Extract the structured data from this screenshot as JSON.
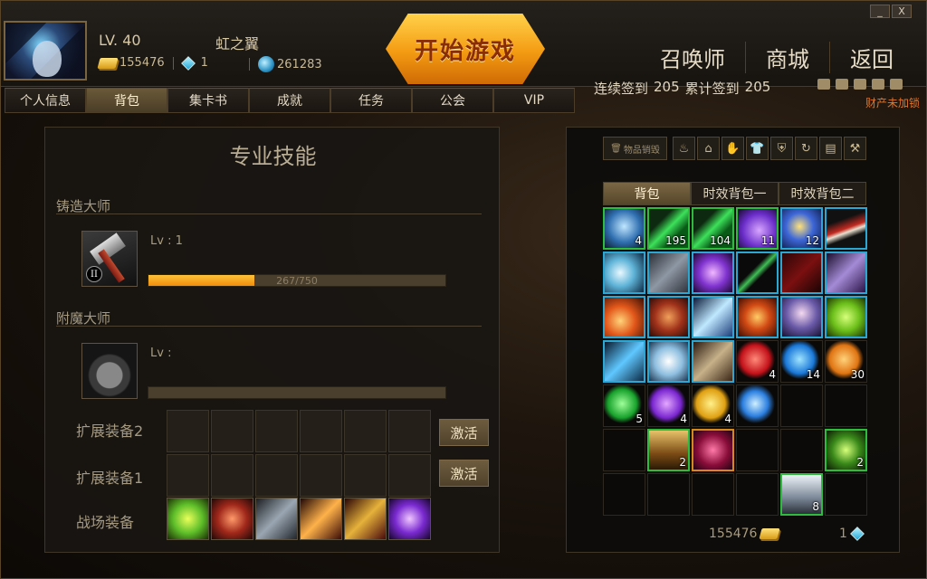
{
  "window": {
    "minimize": "_",
    "close": "X"
  },
  "player": {
    "level": "LV. 40",
    "name": "虹之翼",
    "gold": "155476",
    "gems": "1",
    "points": "261283"
  },
  "start_button": "开始游戏",
  "top_nav": [
    "召唤师",
    "商城",
    "返回"
  ],
  "tabs": [
    "个人信息",
    "背包",
    "集卡书",
    "成就",
    "任务",
    "公会",
    "VIP"
  ],
  "active_tab": "背包",
  "signin": {
    "consecutive_label": "连续签到",
    "consecutive_value": "205",
    "total_label": "累计签到",
    "total_value": "205"
  },
  "asset_lock": "财产未加锁",
  "skills_panel": {
    "title": "专业技能",
    "forge": {
      "name": "铸造大师",
      "lv": "Lv : 1",
      "progress_text": "267/750",
      "progress": 0.356,
      "roman": "II"
    },
    "enchant": {
      "name": "附魔大师",
      "lv": "Lv :",
      "progress": 0
    }
  },
  "equipment_rows": [
    {
      "label": "扩展装备2",
      "button": "激活"
    },
    {
      "label": "扩展装备1",
      "button": "激活"
    },
    {
      "label": "战场装备"
    }
  ],
  "bag_panel": {
    "sell_label": "物品销毁",
    "tabs": [
      "背包",
      "时效背包一",
      "时效背包二"
    ],
    "active_tab": "背包",
    "gold": "155476",
    "gems": "1"
  },
  "colors": {
    "accent": "#f39b12",
    "lock_warning": "#e2742a",
    "green_border": "#2fbb3e",
    "blue_border": "#2aa7d3"
  },
  "bag_items": [
    {
      "icon": "beast-icon",
      "count": "4",
      "rarity": "g"
    },
    {
      "icon": "green-potion-icon",
      "count": "195",
      "rarity": "g"
    },
    {
      "icon": "green-potion-icon",
      "count": "104",
      "rarity": "g"
    },
    {
      "icon": "purple-potion-icon",
      "count": "11",
      "rarity": "g"
    },
    {
      "icon": "blue-scroll-icon",
      "count": "12",
      "rarity": "b"
    },
    {
      "icon": "red-blade-icon",
      "count": "",
      "rarity": "b"
    },
    {
      "icon": "ice-wave-icon",
      "count": "",
      "rarity": "b"
    },
    {
      "icon": "grey-rune-icon",
      "count": "",
      "rarity": "b"
    },
    {
      "icon": "purple-wing-icon",
      "count": "",
      "rarity": "b"
    },
    {
      "icon": "green-sword-icon",
      "count": "",
      "rarity": "b"
    },
    {
      "icon": "red-card-icon",
      "count": "",
      "rarity": "b"
    },
    {
      "icon": "purple-blades-icon",
      "count": "",
      "rarity": "b"
    },
    {
      "icon": "fire-slash-icon",
      "count": "",
      "rarity": "b"
    },
    {
      "icon": "red-spiral-icon",
      "count": "",
      "rarity": "b"
    },
    {
      "icon": "blue-swords-icon",
      "count": "",
      "rarity": "b"
    },
    {
      "icon": "red-wheel-icon",
      "count": "",
      "rarity": "b"
    },
    {
      "icon": "mage-icon",
      "count": "",
      "rarity": "b"
    },
    {
      "icon": "green-face-icon",
      "count": "",
      "rarity": "b"
    },
    {
      "icon": "ice-scythe-icon",
      "count": "",
      "rarity": "b"
    },
    {
      "icon": "angel-wings-icon",
      "count": "",
      "rarity": "b"
    },
    {
      "icon": "crossbow-icon",
      "count": "",
      "rarity": "b"
    },
    {
      "icon": "red-gem-icon",
      "count": "4",
      "rarity": "e"
    },
    {
      "icon": "blue-gem-icon",
      "count": "14",
      "rarity": "e"
    },
    {
      "icon": "orange-gem-icon",
      "count": "30",
      "rarity": "e"
    },
    {
      "icon": "green-gem-icon",
      "count": "5",
      "rarity": "e"
    },
    {
      "icon": "purple-gem-icon",
      "count": "4",
      "rarity": "e"
    },
    {
      "icon": "yellow-gem-icon",
      "count": "4",
      "rarity": "e"
    },
    {
      "icon": "blue-crystal-icon",
      "count": "",
      "rarity": "e"
    },
    {
      "icon": "",
      "count": "",
      "rarity": "e"
    },
    {
      "icon": "",
      "count": "",
      "rarity": "e"
    },
    {
      "icon": "",
      "count": "",
      "rarity": "e"
    },
    {
      "icon": "chest-icon",
      "count": "2",
      "rarity": "g"
    },
    {
      "icon": "hourglass-icon",
      "count": "",
      "rarity": "o"
    },
    {
      "icon": "",
      "count": "",
      "rarity": "e"
    },
    {
      "icon": "",
      "count": "",
      "rarity": "e"
    },
    {
      "icon": "green-emblem-icon",
      "count": "2",
      "rarity": "g"
    },
    {
      "icon": "",
      "count": "",
      "rarity": "e"
    },
    {
      "icon": "",
      "count": "",
      "rarity": "e"
    },
    {
      "icon": "",
      "count": "",
      "rarity": "e"
    },
    {
      "icon": "",
      "count": "",
      "rarity": "e"
    },
    {
      "icon": "silver-chest-icon",
      "count": "8",
      "rarity": "g"
    },
    {
      "icon": "",
      "count": "",
      "rarity": "e"
    }
  ],
  "battle_equipment": [
    "green-boot-icon",
    "axe-icon",
    "hammer-icon",
    "flame-staff-icon",
    "red-spear-icon",
    "purple-bow-icon"
  ]
}
